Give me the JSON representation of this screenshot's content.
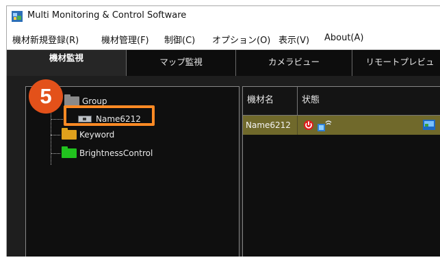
{
  "window": {
    "title": "Multi Monitoring & Control Software"
  },
  "menu": {
    "items": [
      "機材新規登録(R)",
      "機材管理(F)",
      "制御(C)",
      "オプション(O)",
      "表示(V)",
      "About(A)"
    ]
  },
  "tabs": [
    {
      "label": "機材監視",
      "active": true
    },
    {
      "label": "マップ監視",
      "active": false
    },
    {
      "label": "カメラビュー",
      "active": false
    },
    {
      "label": "リモートプレビュ",
      "active": false
    }
  ],
  "tree": {
    "group_label": "Group",
    "device_label": "Name6212",
    "keyword_label": "Keyword",
    "brightness_label": "BrightnessControl"
  },
  "callout": {
    "number": "5",
    "badge_color": "#e3511a",
    "box_color": "#ff8a24"
  },
  "device_list": {
    "columns": [
      "機材名",
      "状態"
    ],
    "rows": [
      {
        "name": "Name6212"
      }
    ],
    "selected_row_color": "#70692b"
  },
  "icons": [
    "app-icon",
    "power-icon",
    "network-signal-icon",
    "monitor-icon",
    "camera-icon",
    "folder-icon"
  ]
}
